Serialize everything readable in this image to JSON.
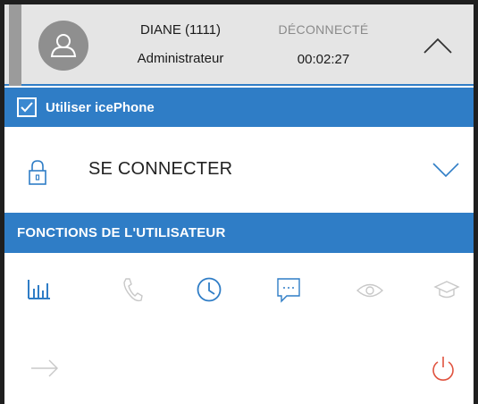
{
  "header": {
    "user_name": "DIANE (1111)",
    "user_role": "Administrateur",
    "status": "DÉCONNECTÉ",
    "timer": "00:02:27",
    "icons": {
      "avatar": "user-avatar-icon",
      "collapse": "chevron-up-icon"
    }
  },
  "icephone": {
    "label": "Utiliser icePhone",
    "checked": true
  },
  "connect": {
    "label": "SE CONNECTER",
    "icons": {
      "lock": "lock-icon",
      "expand": "chevron-down-icon"
    }
  },
  "functions": {
    "title": "FONCTIONS DE L'UTILISATEUR",
    "icons": [
      "statistics-icon",
      "phone-icon",
      "clock-icon",
      "chat-icon",
      "eye-icon",
      "graduation-cap-icon"
    ]
  },
  "bottom": {
    "icons": [
      "arrow-right-icon",
      "power-icon"
    ]
  },
  "colors": {
    "accent": "#2f7dc6",
    "header_bg": "#e5e5e5",
    "power": "#e0533f",
    "muted_icon": "#c8c8c8"
  }
}
